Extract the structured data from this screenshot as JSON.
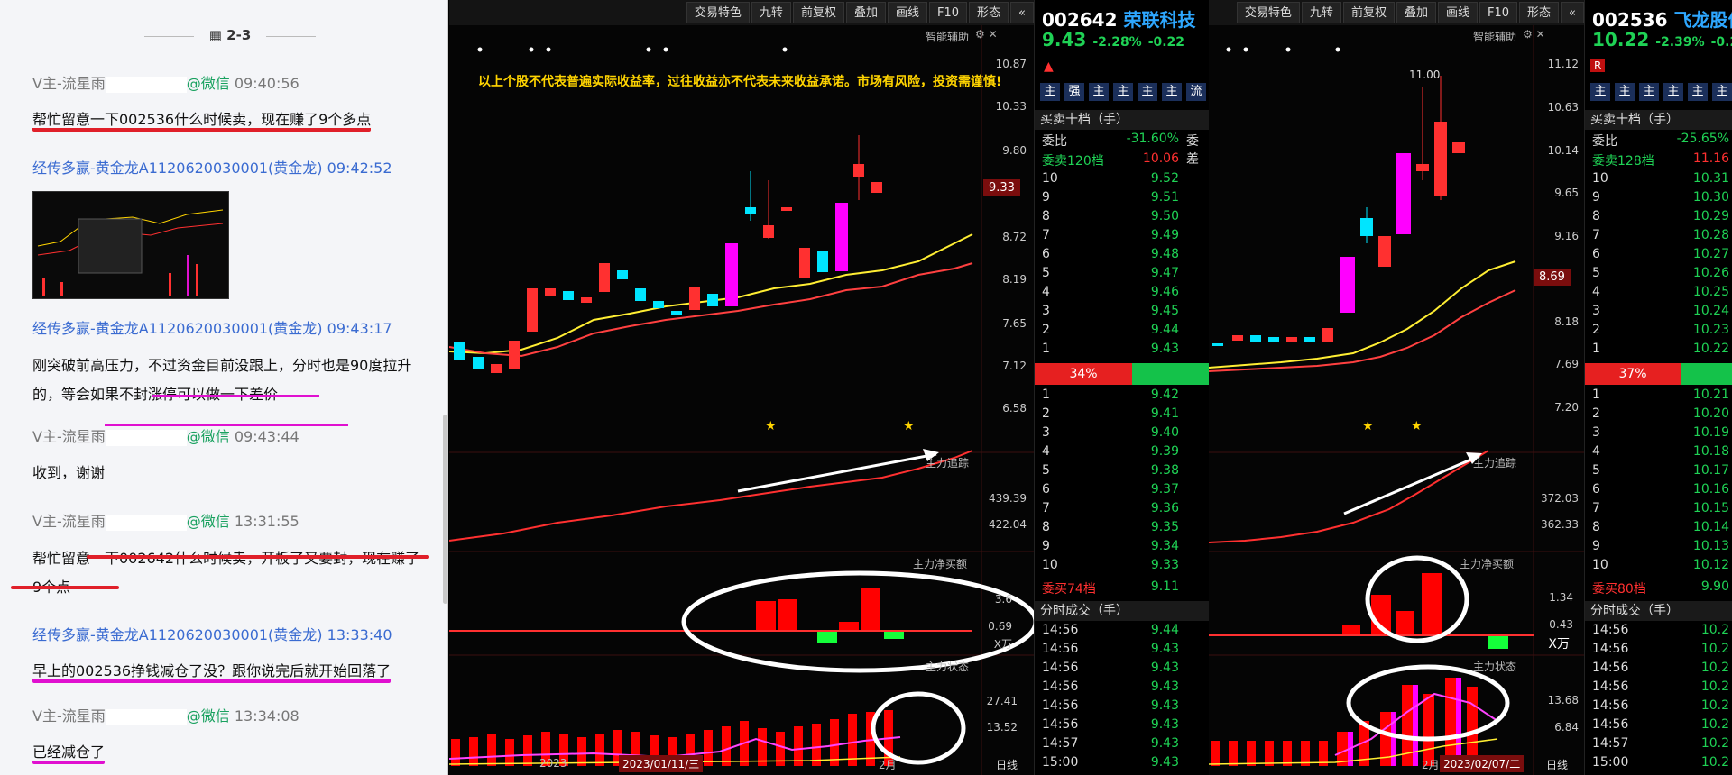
{
  "chat": {
    "date": "2-3",
    "messages": [
      {
        "sender": "V主-流星雨",
        "via": "@微信",
        "time": "09:40:56",
        "text": "帮忙留意一下002536什么时候卖，现在赚了9个多点"
      },
      {
        "sender": "经传多赢-黄金龙A1120620030001(黄金龙)",
        "time": "09:42:52",
        "image": true
      },
      {
        "sender": "经传多赢-黄金龙A1120620030001(黄金龙)",
        "time": "09:43:17",
        "text1": "刚突破前高压力，不过资金目前没跟上，分时也是90度拉升",
        "text2": "的，等会如果不封涨停可以做一下差价"
      },
      {
        "sender": "V主-流星雨",
        "via": "@微信",
        "time": "09:43:44",
        "text": "收到，谢谢"
      },
      {
        "sender": "V主-流星雨",
        "via": "@微信",
        "time": "13:31:55",
        "text1": "帮忙留意一下002642什么时候卖，开板了又要封，现在赚了",
        "text2": "9个点"
      },
      {
        "sender": "经传多赢-黄金龙A1120620030001(黄金龙)",
        "time": "13:33:40",
        "text": "早上的002536挣钱减仓了没？跟你说完后就开始回落了"
      },
      {
        "sender": "V主-流星雨",
        "via": "@微信",
        "time": "13:34:08",
        "text": "已经减仓了"
      }
    ]
  },
  "toolbar": {
    "items": [
      "交易特色",
      "九转",
      "前复权",
      "叠加",
      "画线",
      "F10",
      "形态",
      "«"
    ]
  },
  "chart1": {
    "assist_label": "智能辅助",
    "warning": "以上个股不代表普遍实际收益率，过往收益亦不代表未来收益承诺。市场有风险，投资需谨慎!",
    "price_ticks": [
      "10.87",
      "10.33",
      "9.80",
      "9.33",
      "8.72",
      "8.19",
      "7.65",
      "7.12",
      "6.58"
    ],
    "current": "9.33",
    "ind1_label": "主力追踪",
    "ind1_ticks": [
      "439.39",
      "422.04"
    ],
    "ind2_label": "主力净买额",
    "ind2_ticks": [
      "3.6",
      "0.69",
      "X万"
    ],
    "ind3_label": "主力状态",
    "ind3_ticks": [
      "27.41",
      "13.52"
    ],
    "x_labels": [
      "2023",
      "2023/01/11/三",
      "2月"
    ],
    "period": "日线"
  },
  "book1": {
    "code": "002642",
    "name": "荣联科技",
    "price": "9.43",
    "chg_pct": "-2.28%",
    "chg": "-0.22",
    "btns": [
      "主",
      "强",
      "主",
      "主",
      "主",
      "主",
      "流",
      "K"
    ],
    "book_title": "买卖十档（手）",
    "weibi_label": "委比",
    "weibi": "-31.60%",
    "weicha_label": "委差",
    "sell_total_label": "委卖120档",
    "sell_total": "10.06",
    "sells": [
      [
        "10",
        "9.52"
      ],
      [
        "9",
        "9.51"
      ],
      [
        "8",
        "9.50"
      ],
      [
        "7",
        "9.49"
      ],
      [
        "6",
        "9.48"
      ],
      [
        "5",
        "9.47"
      ],
      [
        "4",
        "9.46"
      ],
      [
        "3",
        "9.45"
      ],
      [
        "2",
        "9.44"
      ],
      [
        "1",
        "9.43"
      ]
    ],
    "ratio": "34%",
    "buys": [
      [
        "1",
        "9.42"
      ],
      [
        "2",
        "9.41"
      ],
      [
        "3",
        "9.40"
      ],
      [
        "4",
        "9.39"
      ],
      [
        "5",
        "9.38"
      ],
      [
        "6",
        "9.37"
      ],
      [
        "7",
        "9.36"
      ],
      [
        "8",
        "9.35"
      ],
      [
        "9",
        "9.34"
      ],
      [
        "10",
        "9.33"
      ]
    ],
    "buy_total_label": "委买74档",
    "buy_total": "9.11",
    "trades_title": "分时成交（手）",
    "trades": [
      [
        "14:56",
        "9.44"
      ],
      [
        "14:56",
        "9.43"
      ],
      [
        "14:56",
        "9.43"
      ],
      [
        "14:56",
        "9.43"
      ],
      [
        "14:56",
        "9.43"
      ],
      [
        "14:56",
        "9.43"
      ],
      [
        "14:57",
        "9.43"
      ],
      [
        "15:00",
        "9.43"
      ]
    ]
  },
  "chart2": {
    "assist_label": "智能辅助",
    "high_label": "11.00",
    "price_ticks": [
      "11.12",
      "10.63",
      "10.14",
      "9.65",
      "9.16",
      "8.69",
      "8.18",
      "7.69",
      "7.20"
    ],
    "current": "8.69",
    "ind1_label": "主力追踪",
    "ind1_ticks": [
      "372.03",
      "362.33"
    ],
    "ind2_label": "主力净买额",
    "ind2_ticks": [
      "1.34",
      "0.43",
      "X万"
    ],
    "ind3_label": "主力状态",
    "ind3_ticks": [
      "13.68",
      "6.84"
    ],
    "x_labels": [
      "2月",
      "2023/02/07/二"
    ],
    "period": "日线"
  },
  "book2": {
    "code": "002536",
    "name": "飞龙股份",
    "price": "10.22",
    "chg_pct": "-2.39%",
    "chg": "-0.25",
    "btns": [
      "主",
      "主",
      "主",
      "主",
      "主",
      "主"
    ],
    "tag": "R",
    "book_title": "买卖十档（手）",
    "weibi_label": "委比",
    "weibi": "-25.65%",
    "sell_total_label": "委卖128档",
    "sell_total": "11.16",
    "sells": [
      [
        "10",
        "10.31"
      ],
      [
        "9",
        "10.30"
      ],
      [
        "8",
        "10.29"
      ],
      [
        "7",
        "10.28"
      ],
      [
        "6",
        "10.27"
      ],
      [
        "5",
        "10.26"
      ],
      [
        "4",
        "10.25"
      ],
      [
        "3",
        "10.24"
      ],
      [
        "2",
        "10.23"
      ],
      [
        "1",
        "10.22"
      ]
    ],
    "ratio": "37%",
    "buys": [
      [
        "1",
        "10.21"
      ],
      [
        "2",
        "10.20"
      ],
      [
        "3",
        "10.19"
      ],
      [
        "4",
        "10.18"
      ],
      [
        "5",
        "10.17"
      ],
      [
        "6",
        "10.16"
      ],
      [
        "7",
        "10.15"
      ],
      [
        "8",
        "10.14"
      ],
      [
        "9",
        "10.13"
      ],
      [
        "10",
        "10.12"
      ]
    ],
    "buy_total_label": "委买80档",
    "buy_total": "9.90",
    "trades_title": "分时成交（手）",
    "trades": [
      [
        "14:56",
        "10.2"
      ],
      [
        "14:56",
        "10.2"
      ],
      [
        "14:56",
        "10.2"
      ],
      [
        "14:56",
        "10.2"
      ],
      [
        "14:56",
        "10.2"
      ],
      [
        "14:56",
        "10.2"
      ],
      [
        "14:57",
        "10.2"
      ],
      [
        "15:00",
        "10.2"
      ]
    ]
  }
}
